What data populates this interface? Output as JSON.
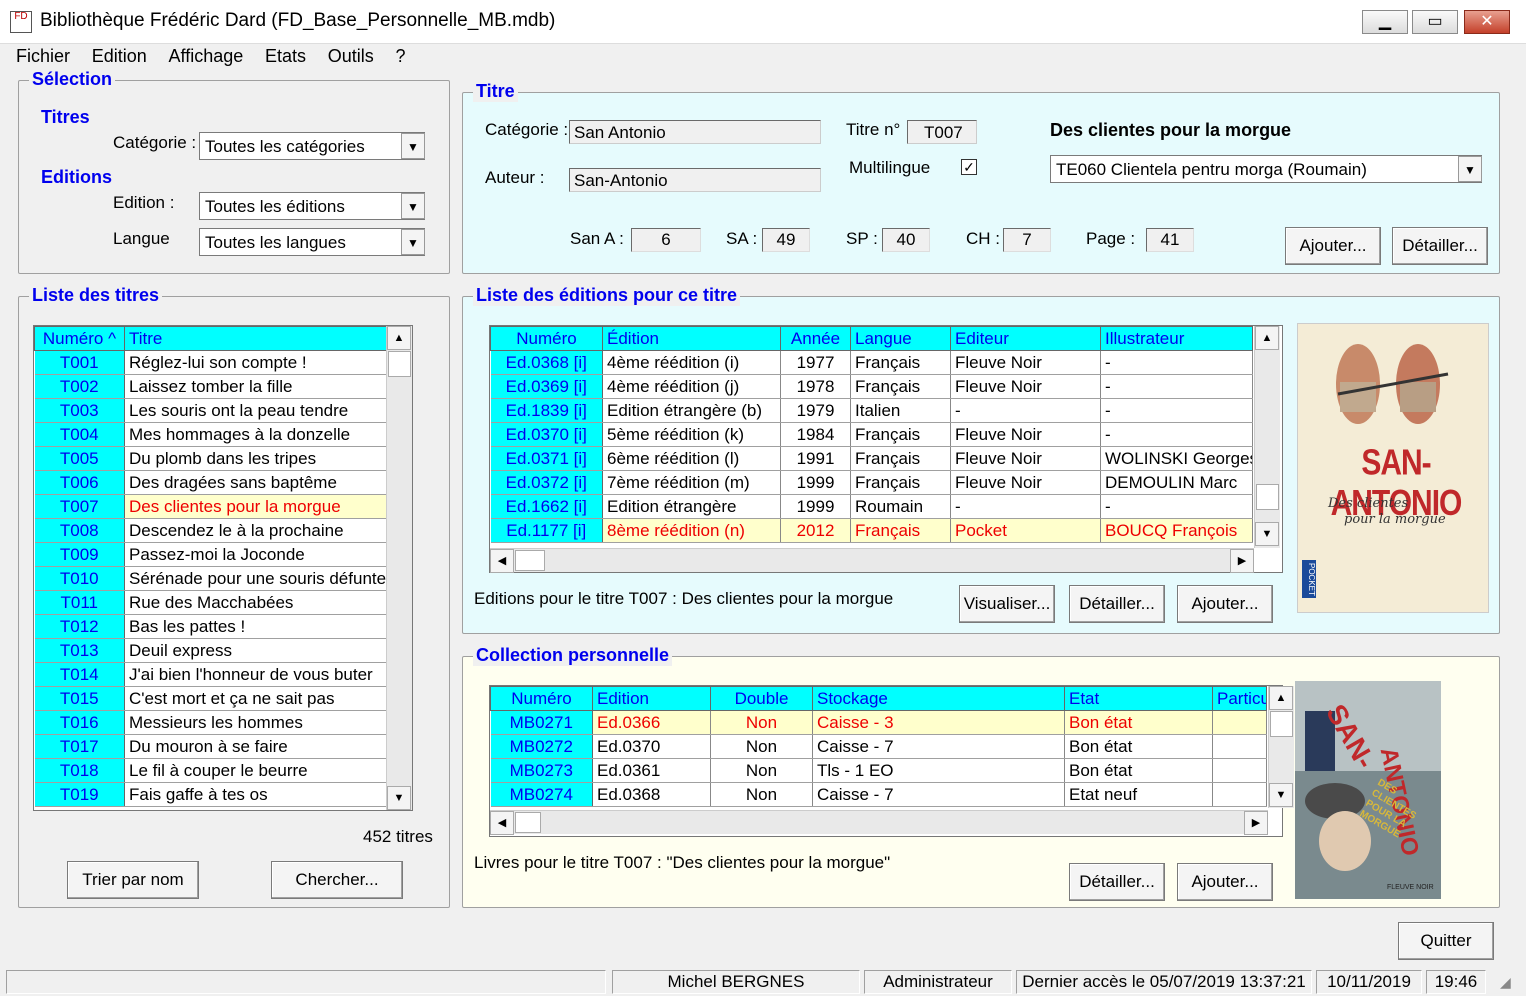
{
  "window": {
    "title": "Bibliothèque Frédéric Dard (FD_Base_Personnelle_MB.mdb)",
    "icon_text": "FD",
    "minimize": "▁",
    "maximize": "▭",
    "close": "✕"
  },
  "menu": [
    "Fichier",
    "Edition",
    "Affichage",
    "Etats",
    "Outils",
    "?"
  ],
  "selection": {
    "legend": "Sélection",
    "titres_label": "Titres",
    "categorie_label": "Catégorie :",
    "categorie_value": "Toutes les catégories",
    "editions_label": "Editions",
    "edition_label": "Edition :",
    "edition_value": "Toutes les éditions",
    "langue_label": "Langue",
    "langue_value": "Toutes les langues"
  },
  "titre": {
    "legend": "Titre",
    "categorie_label": "Catégorie :",
    "categorie_value": "San Antonio",
    "auteur_label": "Auteur :",
    "auteur_value": "San-Antonio",
    "titre_no_label": "Titre n°",
    "titre_no_value": "T007",
    "multilingue_label": "Multilingue",
    "multilingue_checked": "✓",
    "book_title": "Des clientes pour la morgue",
    "translation_value": "TE060 Clientela pentru morga (Roumain)",
    "stats": [
      {
        "label": "San A :",
        "value": "6"
      },
      {
        "label": "SA :",
        "value": "49"
      },
      {
        "label": "SP :",
        "value": "40"
      },
      {
        "label": "CH :",
        "value": "7"
      },
      {
        "label": "Page :",
        "value": "41"
      }
    ],
    "ajouter": "Ajouter...",
    "detailler": "Détailler..."
  },
  "liste_titres": {
    "legend": "Liste des titres",
    "headers": [
      "Numéro ^",
      "Titre"
    ],
    "rows": [
      [
        "T001",
        "Réglez-lui son compte !"
      ],
      [
        "T002",
        "Laissez tomber la fille"
      ],
      [
        "T003",
        "Les souris ont la peau tendre"
      ],
      [
        "T004",
        "Mes hommages à la donzelle"
      ],
      [
        "T005",
        "Du plomb dans les tripes"
      ],
      [
        "T006",
        "Des dragées sans baptême"
      ],
      [
        "T007",
        "Des clientes pour la morgue"
      ],
      [
        "T008",
        "Descendez le à la prochaine"
      ],
      [
        "T009",
        "Passez-moi la Joconde"
      ],
      [
        "T010",
        "Sérénade pour une souris défunte"
      ],
      [
        "T011",
        "Rue des Macchabées"
      ],
      [
        "T012",
        "Bas les pattes !"
      ],
      [
        "T013",
        "Deuil express"
      ],
      [
        "T014",
        "J'ai bien l'honneur de vous buter"
      ],
      [
        "T015",
        "C'est mort et ça ne sait pas"
      ],
      [
        "T016",
        "Messieurs les hommes"
      ],
      [
        "T017",
        "Du mouron à se faire"
      ],
      [
        "T018",
        "Le fil à couper le beurre"
      ],
      [
        "T019",
        "Fais gaffe à tes os"
      ]
    ],
    "selected_row": 6,
    "count": "452 titres",
    "trier": "Trier par nom",
    "chercher": "Chercher..."
  },
  "liste_editions": {
    "legend": "Liste des éditions pour ce titre",
    "headers": [
      "Numéro",
      "Édition",
      "Année",
      "Langue",
      "Editeur",
      "Illustrateur"
    ],
    "rows": [
      [
        "Ed.0368 [i]",
        "4ème réédition (i)",
        "1977",
        "Français",
        "Fleuve Noir",
        "-"
      ],
      [
        "Ed.0369 [i]",
        "4ème réédition (j)",
        "1978",
        "Français",
        "Fleuve Noir",
        "-"
      ],
      [
        "Ed.1839 [i]",
        "Edition étrangère (b)",
        "1979",
        "Italien",
        "-",
        "-"
      ],
      [
        "Ed.0370 [i]",
        "5ème réédition (k)",
        "1984",
        "Français",
        "Fleuve Noir",
        "-"
      ],
      [
        "Ed.0371 [i]",
        "6ème réédition (l)",
        "1991",
        "Français",
        "Fleuve Noir",
        "WOLINSKI Georges"
      ],
      [
        "Ed.0372 [i]",
        "7ème réédition (m)",
        "1999",
        "Français",
        "Fleuve Noir",
        "DEMOULIN Marc"
      ],
      [
        "Ed.1662 [i]",
        "Edition étrangère",
        "1999",
        "Roumain",
        "-",
        "-"
      ],
      [
        "Ed.1177 [i]",
        "8ème réédition (n)",
        "2012",
        "Français",
        "Pocket",
        "BOUCQ François"
      ]
    ],
    "selected_row": 7,
    "caption": "Editions pour le titre T007 : Des clientes pour la morgue",
    "visualiser": "Visualiser...",
    "detailler": "Détailler...",
    "ajouter": "Ajouter...",
    "cover": {
      "brand": "SAN-ANTONIO",
      "subtitle_1": "Des clientes",
      "subtitle_2": "pour la morgue",
      "publisher": "POCKET"
    }
  },
  "collection": {
    "legend": "Collection personnelle",
    "headers": [
      "Numéro",
      "Edition",
      "Double",
      "Stockage",
      "Etat",
      "Particu"
    ],
    "rows": [
      [
        "MB0271",
        "Ed.0366",
        "Non",
        "Caisse - 3",
        "Bon état",
        ""
      ],
      [
        "MB0272",
        "Ed.0370",
        "Non",
        "Caisse - 7",
        "Bon état",
        ""
      ],
      [
        "MB0273",
        "Ed.0361",
        "Non",
        "Tls - 1 EO",
        "Bon état",
        ""
      ],
      [
        "MB0274",
        "Ed.0368",
        "Non",
        "Caisse - 7",
        "Etat neuf",
        ""
      ]
    ],
    "selected_row": 0,
    "caption": "Livres pour le titre T007 : \"Des clientes pour la morgue\"",
    "detailler": "Détailler...",
    "ajouter": "Ajouter...",
    "cover": {
      "brand_1": "SAN-",
      "brand_2": "ANTONIO",
      "subtitle": "DES CLIENTES POUR LA MORGUE",
      "publisher": "FLEUVE NOIR"
    }
  },
  "quitter": "Quitter",
  "status": {
    "user": "Michel BERGNES",
    "role": "Administrateur",
    "last_access": "Dernier accès le 05/07/2019 13:37:21",
    "date": "10/11/2019",
    "time": "19:46"
  }
}
